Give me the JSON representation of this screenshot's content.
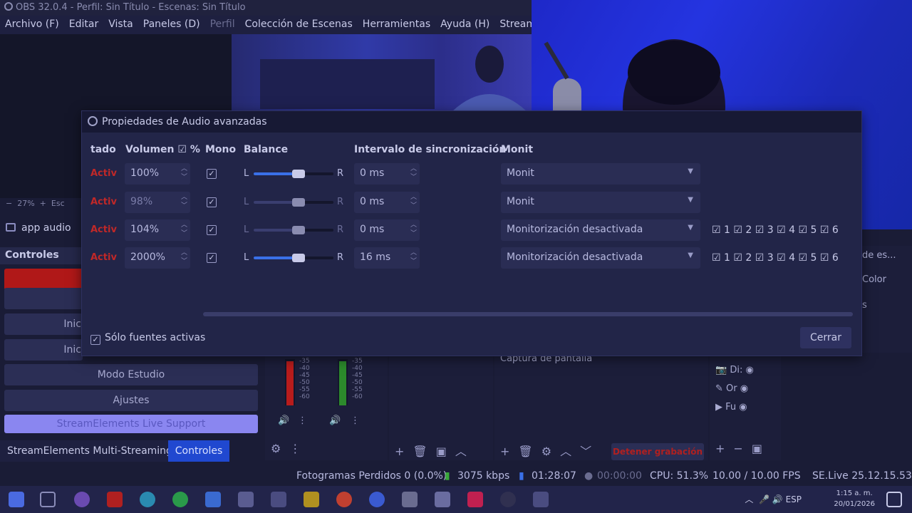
{
  "window": {
    "title": "OBS 32.0.4 - Perfil: Sin Título - Escenas: Sin Título"
  },
  "menu": [
    "Archivo (F)",
    "Editar",
    "Vista",
    "Paneles (D)",
    "Perfil",
    "Colección de Escenas",
    "Herramientas",
    "Ayuda (H)",
    "StreamElements"
  ],
  "preview": {
    "zoom": "27%",
    "zoom_extra": "Esc"
  },
  "sources": {
    "selected": "app audio"
  },
  "controls": {
    "title": "Controles",
    "buttons": {
      "b2": "",
      "b3": "Inic",
      "b4": "Inic",
      "studio": "Modo Estudio",
      "settings": "Ajustes",
      "se_support": "StreamElements Live Support"
    }
  },
  "tabs": {
    "multistream": "StreamElements Multi-Streaming",
    "controls": "Controles"
  },
  "dialog": {
    "title": "Propiedades de Audio avanzadas",
    "columns": {
      "status": "tado",
      "volume": "Volumen",
      "percent": "%",
      "mono": "Mono",
      "balance": "Balance",
      "sync": "Intervalo de sincronización",
      "monitor": "Monit"
    },
    "balance_left": "L",
    "balance_right": "R",
    "rows": [
      {
        "status": "Activ",
        "volume": "100%",
        "sync": "0 ms",
        "monitor": "Monit",
        "balance": 0.5
      },
      {
        "status": "Activ",
        "volume": "98%",
        "sync": "0 ms",
        "monitor": "Monit",
        "balance": 0.5
      },
      {
        "status": "Activ",
        "volume": "104%",
        "sync": "0 ms",
        "monitor": "Monitorización desactivada",
        "balance": 0.5
      },
      {
        "status": "Activ",
        "volume": "2000%",
        "sync": "16 ms",
        "monitor": "Monitorización desactivada",
        "balance": 0.5
      }
    ],
    "tracks": [
      "1",
      "2",
      "3",
      "4",
      "5",
      "6"
    ],
    "active_only": "Sólo fuentes activas",
    "close": "Cerrar"
  },
  "mixer": {
    "scale": [
      "-35",
      "-40",
      "-45",
      "-50",
      "-55",
      "-60"
    ]
  },
  "sources_panel": {
    "item": "Captura de pantalla"
  },
  "transitions": {
    "items": [
      "Di:",
      "Or",
      "Fu"
    ]
  },
  "right_dock": {
    "label1": "de es...",
    "label2": "Color",
    "label3": "s"
  },
  "rec_button": "Detener grabación",
  "status": {
    "dropped": "Fotogramas Perdidos 0 (0.0%)",
    "bitrate": "3075 kbps",
    "stream_time": "01:28:07",
    "rec_time": "00:00:00",
    "cpu": "CPU: 51.3%",
    "fps": "10.00 / 10.00 FPS",
    "version": "SE.Live 25.12.15.535"
  },
  "taskbar": {
    "lang": "ESP",
    "time": "1:15 a. m.",
    "date": "20/01/2026"
  }
}
